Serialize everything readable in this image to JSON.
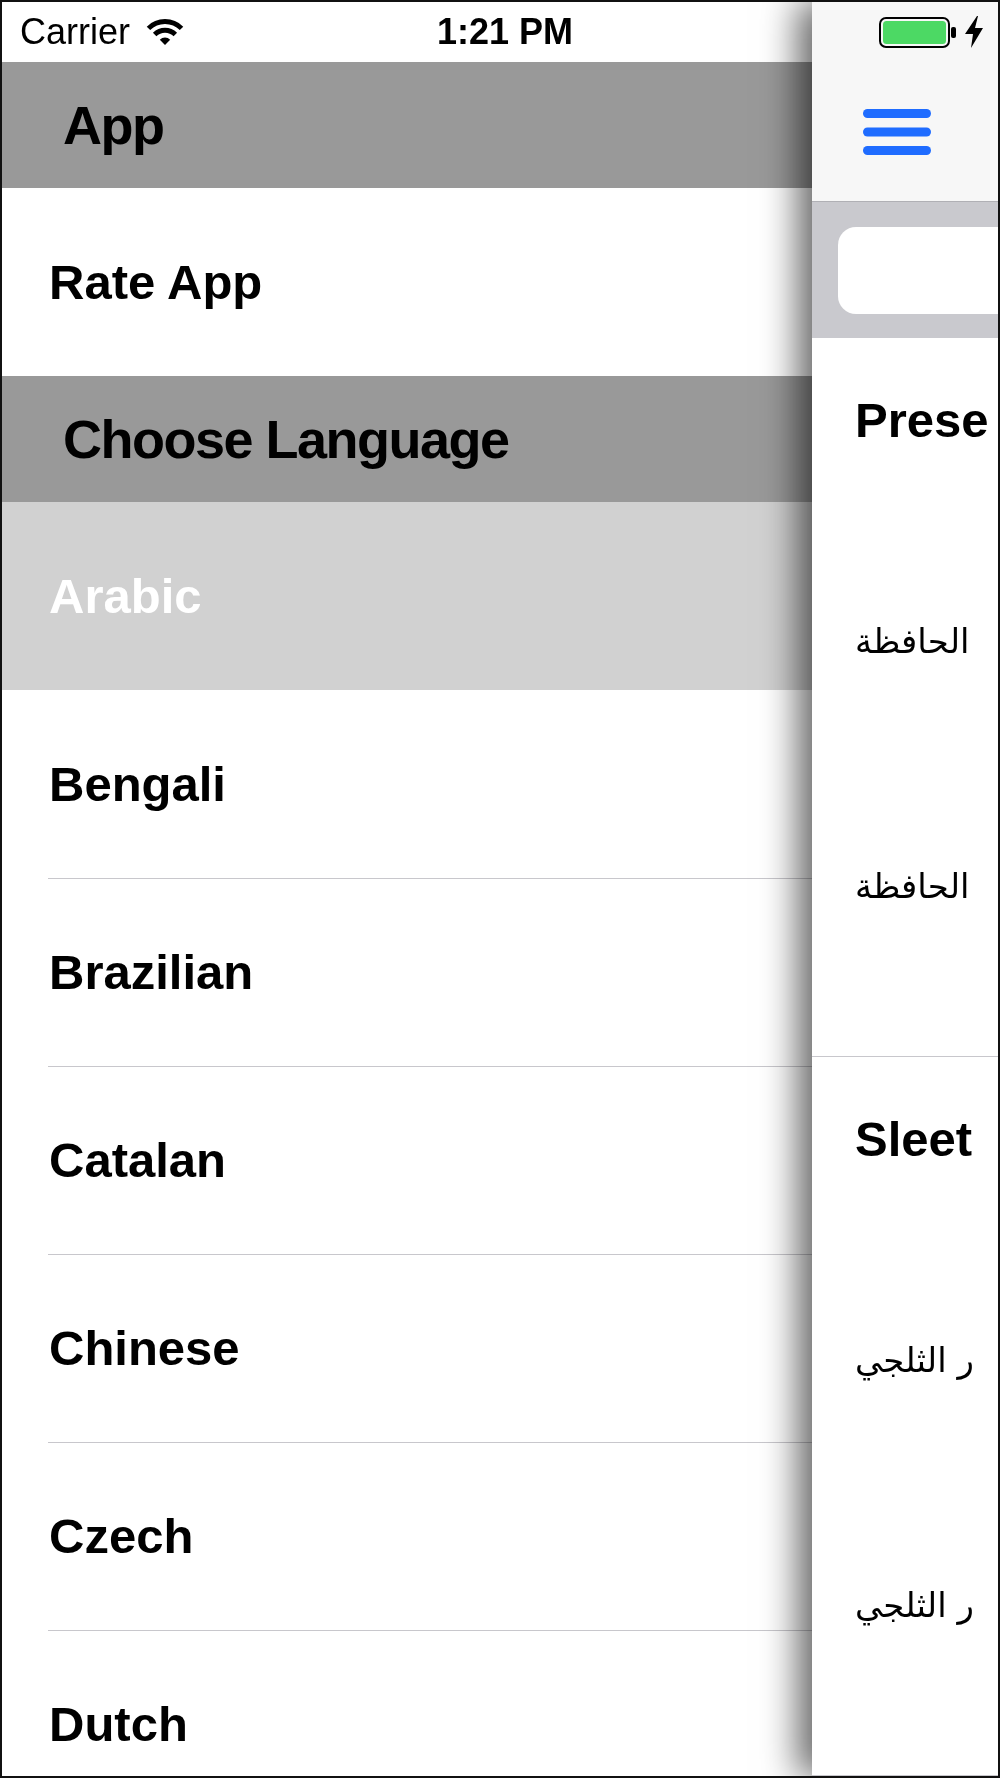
{
  "status_bar": {
    "carrier": "Carrier",
    "time": "1:21 PM"
  },
  "drawer": {
    "sections": [
      {
        "title": "App",
        "items": [
          {
            "label": "Rate App",
            "selected": false
          }
        ]
      },
      {
        "title": "Choose Language",
        "items": [
          {
            "label": "Arabic",
            "selected": true
          },
          {
            "label": "Bengali",
            "selected": false
          },
          {
            "label": "Brazilian",
            "selected": false
          },
          {
            "label": "Catalan",
            "selected": false
          },
          {
            "label": "Chinese",
            "selected": false
          },
          {
            "label": "Czech",
            "selected": false
          },
          {
            "label": "Dutch",
            "selected": false
          }
        ]
      }
    ]
  },
  "content": {
    "sections": [
      {
        "title": "Prese",
        "lines": [
          "الحافظة",
          "الحافظة"
        ]
      },
      {
        "title": "Sleet",
        "lines": [
          "ر الثلجي",
          "ر الثلجي"
        ]
      }
    ]
  }
}
